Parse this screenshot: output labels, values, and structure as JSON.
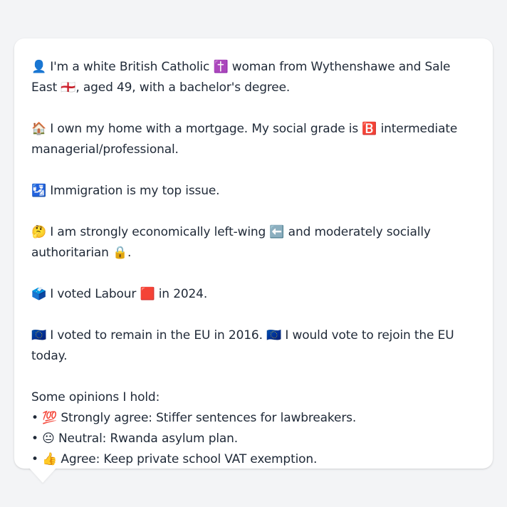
{
  "profile": {
    "identity": "👤 I'm a white British Catholic ✝️ woman from Wythenshawe and Sale East 🏴󠁧󠁢󠁥󠁮󠁧󠁿, aged 49, with a bachelor's degree.",
    "home": "🏠 I own my home with a mortgage. My social grade is 🅱️ intermediate managerial/professional.",
    "top_issue": "🛂 Immigration is my top issue.",
    "ideology": "🤔 I am strongly economically left-wing ⬅️ and moderately socially authoritarian 🔒.",
    "vote_2024": "🗳️ I voted Labour 🟥 in 2024.",
    "eu": "🇪🇺 I voted to remain in the EU in 2016. 🇪🇺 I would vote to rejoin the EU today."
  },
  "opinions": {
    "heading": "Some opinions I hold:",
    "items": [
      "• 💯 Strongly agree: Stiffer sentences for lawbreakers.",
      "• 😐 Neutral: Rwanda asylum plan.",
      "• 👍 Agree: Keep private school VAT exemption."
    ]
  }
}
